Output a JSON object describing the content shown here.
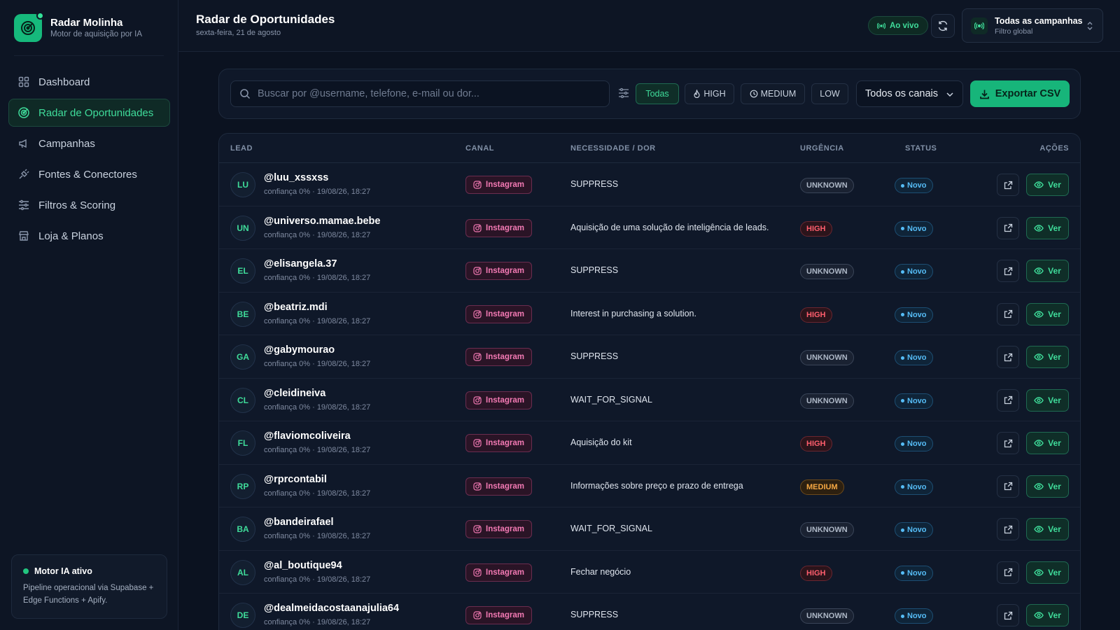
{
  "brand": {
    "name": "Radar Molinha",
    "subtitle": "Motor de aquisição por IA"
  },
  "nav": [
    {
      "label": "Dashboard",
      "icon": "grid-icon",
      "active": false
    },
    {
      "label": "Radar de Oportunidades",
      "icon": "radar-icon",
      "active": true
    },
    {
      "label": "Campanhas",
      "icon": "megaphone-icon",
      "active": false
    },
    {
      "label": "Fontes & Conectores",
      "icon": "plug-icon",
      "active": false
    },
    {
      "label": "Filtros & Scoring",
      "icon": "sliders-icon",
      "active": false
    },
    {
      "label": "Loja & Planos",
      "icon": "store-icon",
      "active": false
    }
  ],
  "motor": {
    "title": "Motor IA ativo",
    "description": "Pipeline operacional via Supabase + Edge Functions + Apify."
  },
  "header": {
    "title": "Radar de Oportunidades",
    "date": "sexta-feira, 21 de agosto",
    "live_label": "Ao vivo",
    "campaign_title": "Todas as campanhas",
    "campaign_sub": "Filtro global"
  },
  "toolbar": {
    "search_placeholder": "Buscar por @username, telefone, e-mail ou dor...",
    "filters": {
      "all": "Todas",
      "high": "HIGH",
      "medium": "MEDIUM",
      "low": "LOW"
    },
    "channel_select": "Todos os canais",
    "export_label": "Exportar CSV"
  },
  "table": {
    "headers": {
      "lead": "LEAD",
      "canal": "CANAL",
      "need": "NECESSIDADE / DOR",
      "urgency": "URGÊNCIA",
      "status": "STATUS",
      "actions": "AÇÕES"
    },
    "view_label": "Ver",
    "rows": [
      {
        "initials": "LU",
        "handle": "@luu_xssxss",
        "meta": "confiança 0% · 19/08/26, 18:27",
        "channel": "Instagram",
        "need": "SUPPRESS",
        "urgency": "UNKNOWN",
        "status": "Novo"
      },
      {
        "initials": "UN",
        "handle": "@universo.mamae.bebe",
        "meta": "confiança 0% · 19/08/26, 18:27",
        "channel": "Instagram",
        "need": "Aquisição de uma solução de inteligência de leads.",
        "urgency": "HIGH",
        "status": "Novo"
      },
      {
        "initials": "EL",
        "handle": "@elisangela.37",
        "meta": "confiança 0% · 19/08/26, 18:27",
        "channel": "Instagram",
        "need": "SUPPRESS",
        "urgency": "UNKNOWN",
        "status": "Novo"
      },
      {
        "initials": "BE",
        "handle": "@beatriz.mdi",
        "meta": "confiança 0% · 19/08/26, 18:27",
        "channel": "Instagram",
        "need": "Interest in purchasing a solution.",
        "urgency": "HIGH",
        "status": "Novo"
      },
      {
        "initials": "GA",
        "handle": "@gabymourao",
        "meta": "confiança 0% · 19/08/26, 18:27",
        "channel": "Instagram",
        "need": "SUPPRESS",
        "urgency": "UNKNOWN",
        "status": "Novo"
      },
      {
        "initials": "CL",
        "handle": "@cleidineiva",
        "meta": "confiança 0% · 19/08/26, 18:27",
        "channel": "Instagram",
        "need": "WAIT_FOR_SIGNAL",
        "urgency": "UNKNOWN",
        "status": "Novo"
      },
      {
        "initials": "FL",
        "handle": "@flaviomcoliveira",
        "meta": "confiança 0% · 19/08/26, 18:27",
        "channel": "Instagram",
        "need": "Aquisição do kit",
        "urgency": "HIGH",
        "status": "Novo"
      },
      {
        "initials": "RP",
        "handle": "@rprcontabil",
        "meta": "confiança 0% · 19/08/26, 18:27",
        "channel": "Instagram",
        "need": "Informações sobre preço e prazo de entrega",
        "urgency": "MEDIUM",
        "status": "Novo"
      },
      {
        "initials": "BA",
        "handle": "@bandeirafael",
        "meta": "confiança 0% · 19/08/26, 18:27",
        "channel": "Instagram",
        "need": "WAIT_FOR_SIGNAL",
        "urgency": "UNKNOWN",
        "status": "Novo"
      },
      {
        "initials": "AL",
        "handle": "@al_boutique94",
        "meta": "confiança 0% · 19/08/26, 18:27",
        "channel": "Instagram",
        "need": "Fechar negócio",
        "urgency": "HIGH",
        "status": "Novo"
      },
      {
        "initials": "DE",
        "handle": "@dealmeidacostaanajulia64",
        "meta": "confiança 0% · 19/08/26, 18:27",
        "channel": "Instagram",
        "need": "SUPPRESS",
        "urgency": "UNKNOWN",
        "status": "Novo"
      }
    ]
  }
}
